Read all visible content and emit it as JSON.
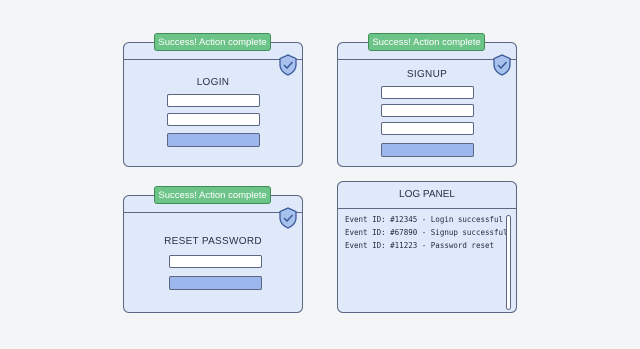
{
  "login_window": {
    "toast": "Success! Action complete",
    "title": "LOGIN"
  },
  "signup_window": {
    "toast": "Success! Action complete",
    "title": "SIGNUP"
  },
  "reset_window": {
    "toast": "Success! Action complete",
    "title": "RESET PASSWORD"
  },
  "log_panel": {
    "title": "LOG PANEL",
    "entries": [
      "Event ID: #12345 - Login successful",
      "Event ID: #67890 - Signup successful",
      "Event ID: #11223 - Password reset"
    ]
  },
  "colors": {
    "window_bg": "#dfe9f9",
    "toast_bg": "#6cc488",
    "button_bg": "#9cb7ec",
    "border": "#5d6784"
  },
  "icons": {
    "shield": "shield-check-icon"
  }
}
